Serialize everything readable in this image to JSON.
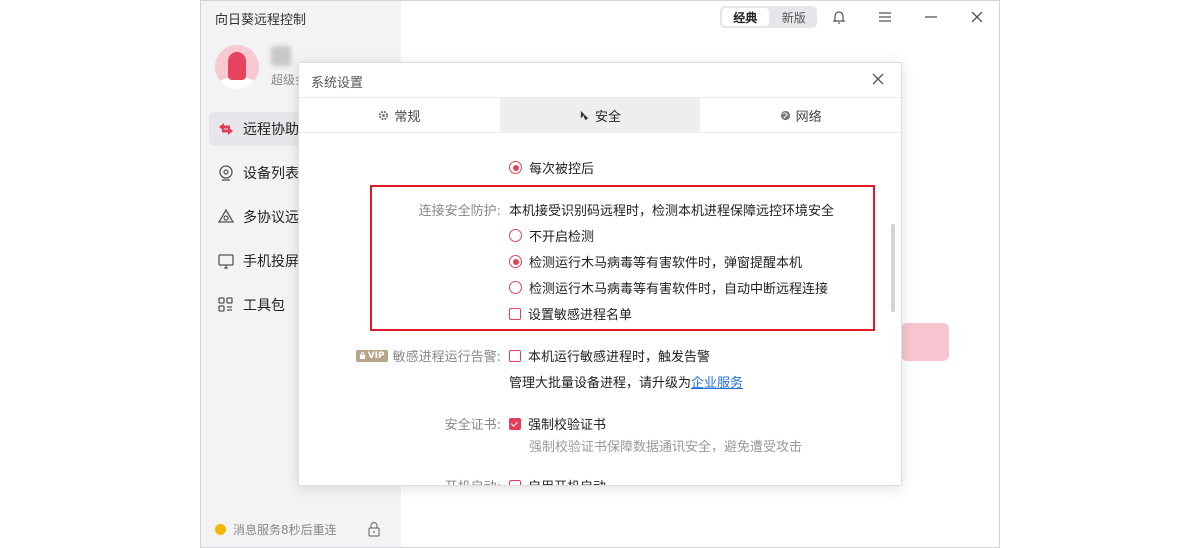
{
  "app": {
    "title": "向日葵远程控制",
    "user_level": "超级会",
    "mode_toggle": {
      "classic": "经典",
      "new": "新版"
    },
    "nav": [
      {
        "label": "远程协助",
        "icon": "swap-arrows-icon",
        "active": true
      },
      {
        "label": "设备列表",
        "icon": "device-list-icon",
        "active": false
      },
      {
        "label": "多协议远控",
        "icon": "multi-protocol-icon",
        "active": false
      },
      {
        "label": "手机投屏",
        "icon": "screen-cast-icon",
        "active": false
      },
      {
        "label": "工具包",
        "icon": "toolbox-icon",
        "active": false
      }
    ],
    "status_text": "消息服务8秒后重连"
  },
  "dialog": {
    "title": "系统设置",
    "tabs": [
      {
        "label": "常规",
        "icon": "gear-icon",
        "active": false
      },
      {
        "label": "安全",
        "icon": "shield-icon",
        "active": true
      },
      {
        "label": "网络",
        "icon": "globe-icon",
        "active": false
      }
    ],
    "prev_option": "每次被控后",
    "connection_protection": {
      "label": "连接安全防护:",
      "description": "本机接受识别码远程时，检测本机进程保障远控环境安全",
      "options": [
        {
          "label": "不开启检测",
          "selected": false
        },
        {
          "label": "检测运行木马病毒等有害软件时，弹窗提醒本机",
          "selected": true
        },
        {
          "label": "检测运行木马病毒等有害软件时，自动中断远程连接",
          "selected": false
        }
      ],
      "sensitive_list_label": "设置敏感进程名单",
      "sensitive_list_checked": false
    },
    "sensitive_alert": {
      "vip_badge": "VIP",
      "label": "敏感进程运行告警:",
      "option_label": "本机运行敏感进程时，触发告警",
      "checked": false,
      "upgrade_text": "管理大批量设备进程，请升级为",
      "upgrade_link": "企业服务"
    },
    "security_cert": {
      "label": "安全证书:",
      "option_label": "强制校验证书",
      "checked": true,
      "hint": "强制校验证书保障数据通讯安全，避免遭受攻击"
    },
    "next_row": {
      "label": "开机启动:",
      "option_label": "启用开机启动"
    }
  },
  "colors": {
    "accent": "#e2405a",
    "highlight_border": "#e0192a",
    "link": "#1f6fe0"
  }
}
